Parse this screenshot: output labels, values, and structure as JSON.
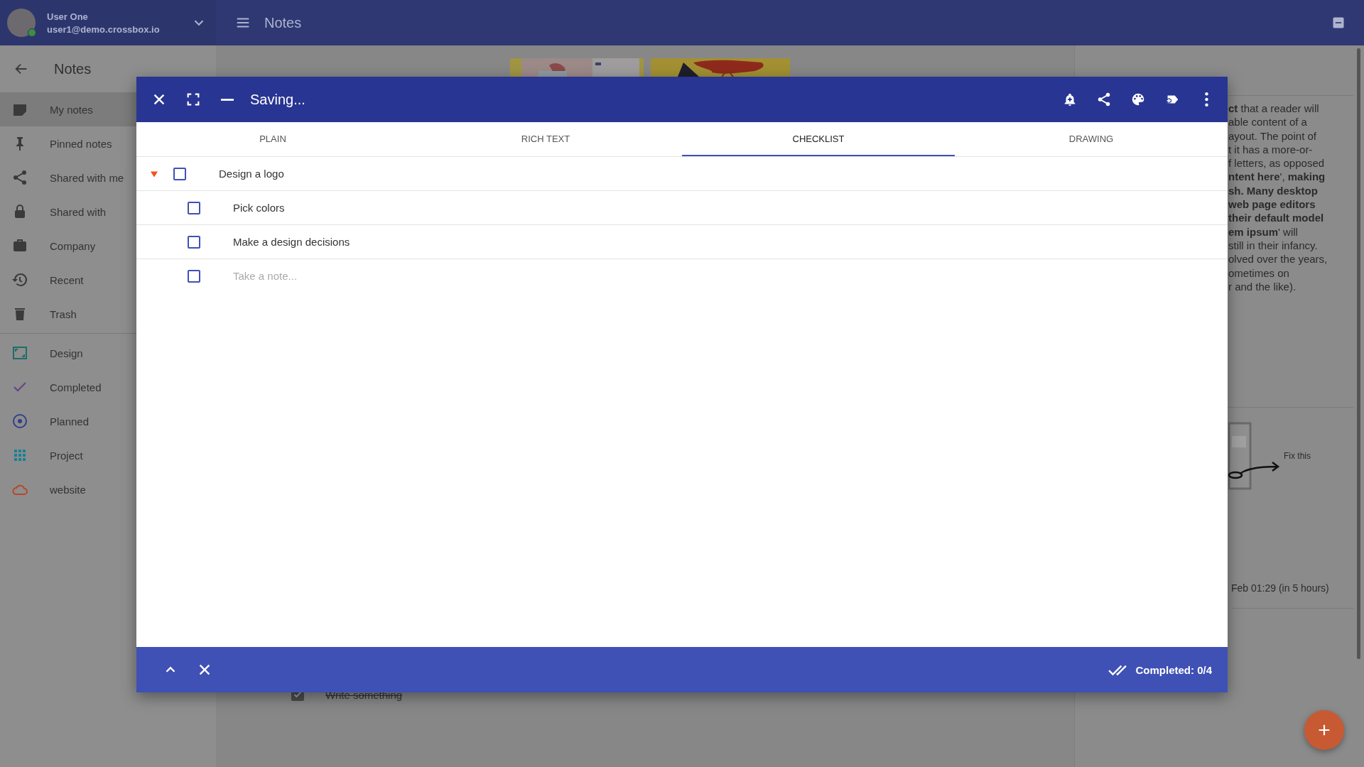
{
  "user": {
    "name": "User One",
    "email": "user1@demo.crossbox.io",
    "online": true
  },
  "app_bar": {
    "title": "Notes"
  },
  "sidebar": {
    "title": "Notes",
    "items": [
      {
        "label": "My notes",
        "kind": "note",
        "selected": true
      },
      {
        "label": "Pinned notes",
        "kind": "pin",
        "selected": false
      },
      {
        "label": "Shared with me",
        "kind": "share",
        "selected": false
      },
      {
        "label": "Shared with",
        "kind": "lock",
        "selected": false
      },
      {
        "label": "Company",
        "kind": "briefcase",
        "selected": false
      },
      {
        "label": "Recent",
        "kind": "history",
        "selected": false
      },
      {
        "label": "Trash",
        "kind": "trash",
        "selected": false
      },
      {
        "label": "Design",
        "kind": "frame",
        "selected": false,
        "color": "#1f6d68"
      },
      {
        "label": "Completed",
        "kind": "check",
        "selected": false,
        "color": "#6c3f86"
      },
      {
        "label": "Planned",
        "kind": "target",
        "selected": false,
        "color": "#33408a"
      },
      {
        "label": "Project",
        "kind": "grid",
        "selected": false,
        "color": "#1b7f96"
      },
      {
        "label": "website",
        "kind": "cloud",
        "selected": false,
        "color": "#b5492a"
      }
    ]
  },
  "background_notes": {
    "excerpt": [
      "**ct** that a reader will",
      "able content of a",
      "ayout. The point of",
      "t it has a more-or-",
      "f letters, as opposed",
      "**ntent here**', **making**",
      "**sh. Many desktop**",
      "**web page editors**",
      "**their default model**",
      "**em ipsum**' will",
      "still in their infancy.",
      "olved over the years,",
      "ometimes on",
      "r and the like)."
    ],
    "drawing_caption": "Fix this",
    "reminder": "Feb 01:29  (in 5 hours)",
    "checklist_item": {
      "text": "Write something",
      "checked": true
    }
  },
  "dialog": {
    "title": "Saving...",
    "tabs": [
      {
        "label": "PLAIN",
        "selected": false
      },
      {
        "label": "RICH TEXT",
        "selected": false
      },
      {
        "label": "CHECKLIST",
        "selected": true
      },
      {
        "label": "DRAWING",
        "selected": false
      }
    ],
    "items": [
      {
        "text": "Design a logo",
        "checked": false,
        "expanded": true,
        "children": [
          {
            "text": "Pick colors",
            "checked": false
          },
          {
            "text": "Make a design decisions",
            "checked": false
          }
        ]
      }
    ],
    "new_item": {
      "placeholder": "Take a note...",
      "checked": false
    },
    "footer": {
      "status": "Completed: 0/4"
    }
  }
}
